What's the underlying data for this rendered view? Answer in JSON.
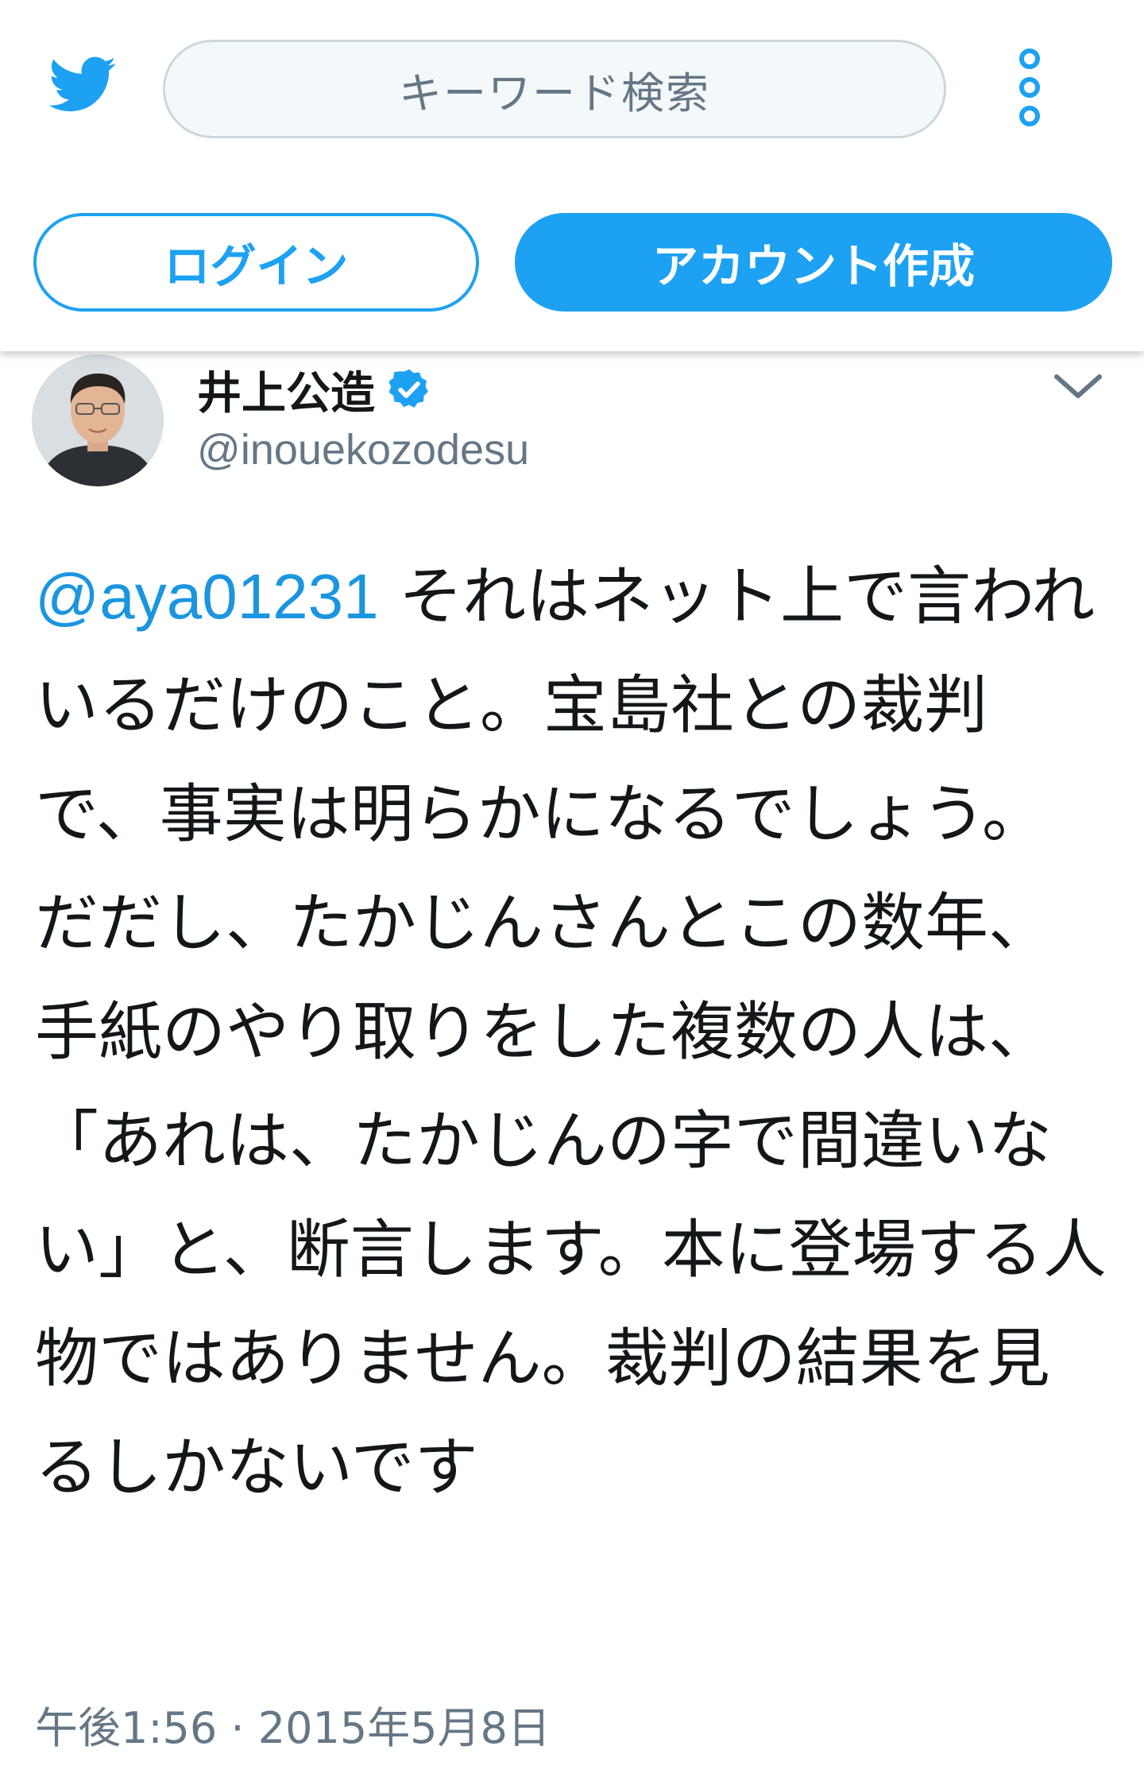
{
  "header": {
    "search_placeholder": "キーワード検索",
    "login_label": "ログイン",
    "signup_label": "アカウント作成"
  },
  "tweet": {
    "display_name": "井上公造",
    "handle": "@inouekozodesu",
    "verified": true,
    "mention": "@aya01231",
    "body": " それはネット上で言われいるだけのこと。宝島社との裁判で、事実は明らかになるでしょう。だだし、たかじんさんとこの数年、手紙のやり取りをした複数の人は、「あれは、たかじんの字で間違いない」と、断言します。本に登場する人物ではありません。裁判の結果を見るしかないです",
    "timestamp": "午後1:56 · 2015年5月8日"
  },
  "colors": {
    "accent": "#1da1f2",
    "link": "#1b95e0",
    "secondary_text": "#657786",
    "primary_text": "#14171a"
  },
  "icons": {
    "logo": "twitter-bird-icon",
    "menu": "more-dots-icon",
    "verified": "verified-badge-icon",
    "dropdown": "chevron-down-icon"
  }
}
